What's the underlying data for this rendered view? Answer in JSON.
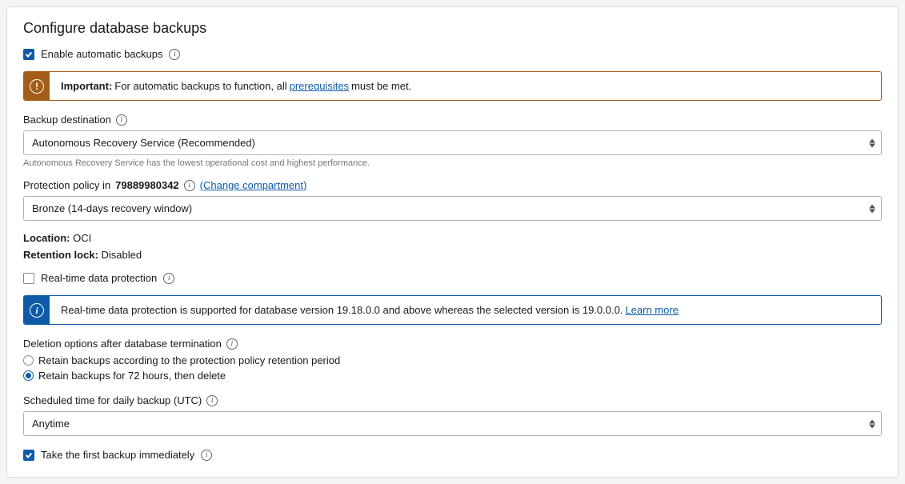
{
  "title": "Configure database backups",
  "enableAutomatic": {
    "label": "Enable automatic backups",
    "checked": true
  },
  "importantAlert": {
    "strong": "Important:",
    "text1": "For automatic backups to function, all",
    "link": "prerequisites",
    "text2": "must be met."
  },
  "backupDestination": {
    "label": "Backup destination",
    "value": "Autonomous Recovery Service (Recommended)",
    "helper": "Autonomous Recovery Service has the lowest operational cost and highest performance."
  },
  "protectionPolicy": {
    "labelPrefix": "Protection policy in",
    "compartment": "79889980342",
    "changeLink": "(Change compartment)",
    "value": "Bronze (14-days recovery window)"
  },
  "location": {
    "label": "Location:",
    "value": "OCI"
  },
  "retentionLock": {
    "label": "Retention lock:",
    "value": "Disabled"
  },
  "realtimeProtection": {
    "label": "Real-time data protection",
    "checked": false
  },
  "realtimeAlert": {
    "text": "Real-time data protection is supported for database version 19.18.0.0 and above whereas the selected version is 19.0.0.0.",
    "link": "Learn more"
  },
  "deletionOptions": {
    "label": "Deletion options after database termination",
    "option1": "Retain backups according to the protection policy retention period",
    "option2": "Retain backups for 72 hours, then delete",
    "selected": 2
  },
  "scheduledTime": {
    "label": "Scheduled time for daily backup (UTC)",
    "value": "Anytime"
  },
  "firstBackup": {
    "label": "Take the first backup immediately",
    "checked": true
  }
}
